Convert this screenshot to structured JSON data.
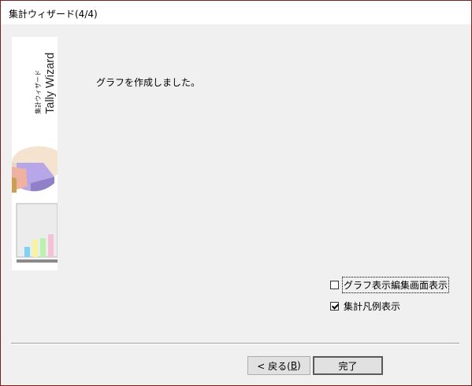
{
  "window": {
    "title": "集計ウィザード(4/4)"
  },
  "sidebar_image": {
    "heading_jp": "集計ウィザード",
    "heading_en": "Tally Wizard",
    "icons": [
      "pie-chart-icon",
      "bar-chart-icon"
    ]
  },
  "main": {
    "message": "グラフを作成しました。"
  },
  "options": [
    {
      "label": "グラフ表示編集画面表示",
      "checked": false
    },
    {
      "label": "集計凡例表示",
      "checked": true
    }
  ],
  "buttons": {
    "back_prefix": "< 戻る(",
    "back_key": "B",
    "back_suffix": ")",
    "finish": "完了"
  }
}
